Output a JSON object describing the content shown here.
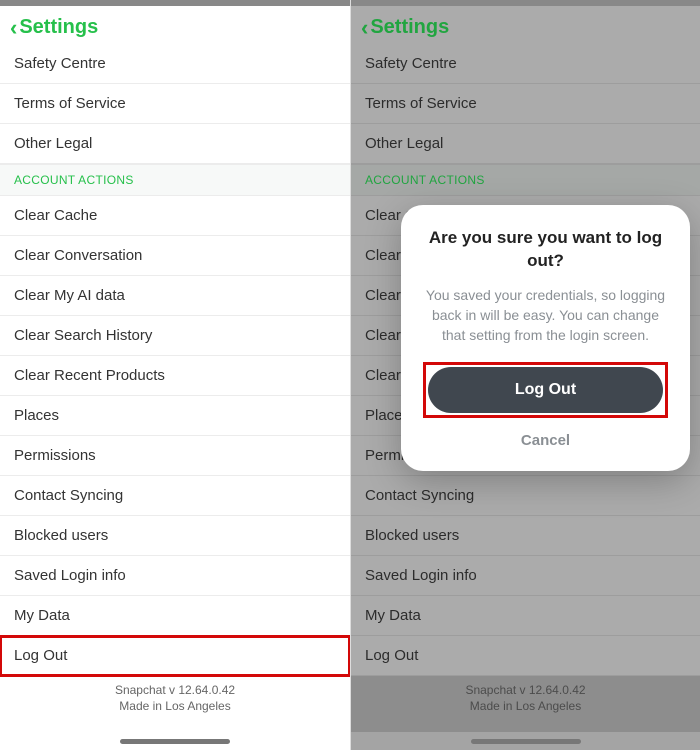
{
  "nav": {
    "title": "Settings"
  },
  "rows_top": [
    "Safety Centre",
    "Terms of Service",
    "Other Legal"
  ],
  "section_header": "ACCOUNT ACTIONS",
  "rows_actions": [
    "Clear Cache",
    "Clear Conversation",
    "Clear My AI data",
    "Clear Search History",
    "Clear Recent Products",
    "Places",
    "Permissions",
    "Contact Syncing",
    "Blocked users",
    "Saved Login info",
    "My Data",
    "Log Out"
  ],
  "footer": {
    "line1": "Snapchat v 12.64.0.42",
    "line2": "Made in Los Angeles"
  },
  "modal": {
    "title": "Are you sure you want to log out?",
    "body": "You saved your credentials, so logging back in will be easy. You can change that setting from the login screen.",
    "primary": "Log Out",
    "cancel": "Cancel"
  },
  "right_rows_actions_truncated": [
    "Clear Cache",
    "Clear Conversation",
    "Clear My AI data",
    "Clear Search History",
    "Clear Recent Products",
    "Places",
    "Permissions",
    "Contact Syncing",
    "Blocked users",
    "Saved Login info",
    "My Data",
    "Log Out"
  ]
}
